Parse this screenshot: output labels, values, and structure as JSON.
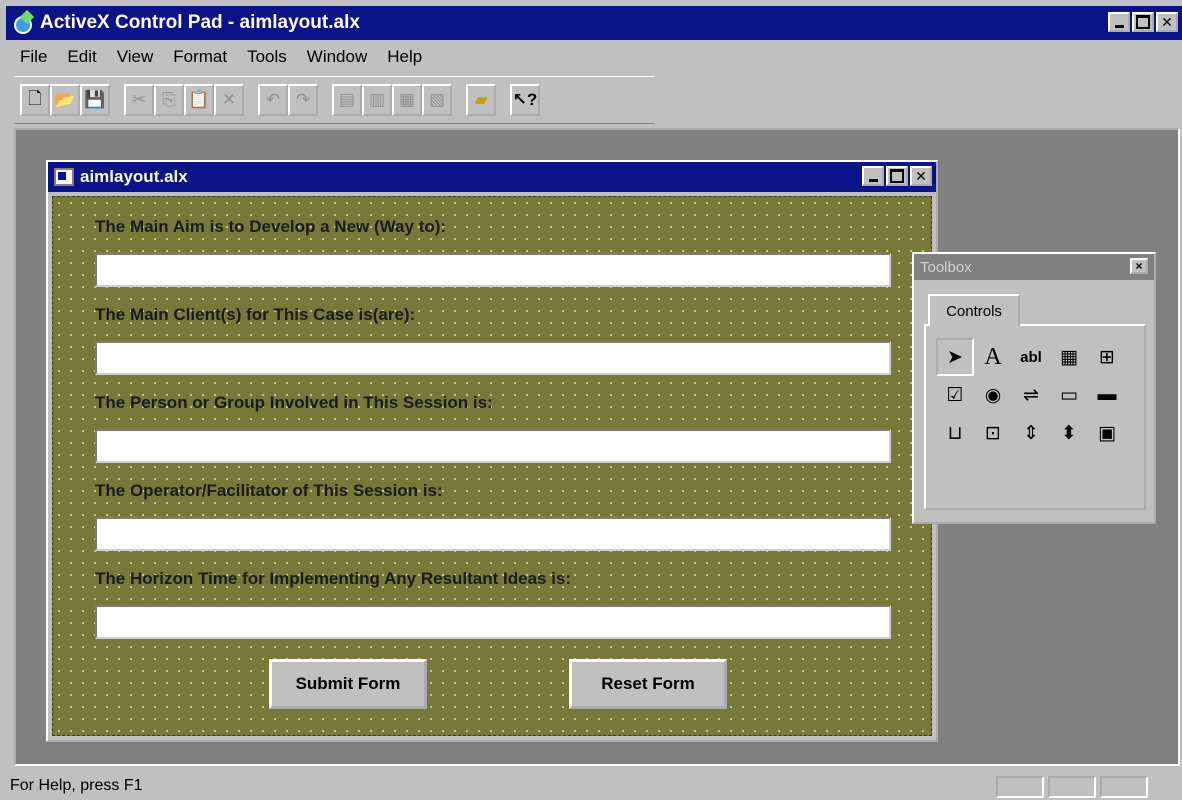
{
  "app": {
    "title": "ActiveX Control Pad - aimlayout.alx",
    "menu": [
      "File",
      "Edit",
      "View",
      "Format",
      "Tools",
      "Window",
      "Help"
    ]
  },
  "toolbar": {
    "new_icon": "new-file-icon",
    "open_icon": "open-folder-icon",
    "save_icon": "save-icon",
    "help_icon": "whats-this-icon"
  },
  "document": {
    "title": "aimlayout.alx",
    "background_color": "#787838",
    "fields": [
      {
        "label": "The Main Aim is to Develop a New (Way to):",
        "value": ""
      },
      {
        "label": "The Main Client(s) for This Case is(are):",
        "value": ""
      },
      {
        "label": "The Person or Group Involved in This Session is:",
        "value": ""
      },
      {
        "label": "The Operator/Facilitator of This Session is:",
        "value": ""
      },
      {
        "label": "The Horizon Time for Implementing Any Resultant Ideas is:",
        "value": ""
      }
    ],
    "submit_label": "Submit Form",
    "reset_label": "Reset Form"
  },
  "toolbox": {
    "title": "Toolbox",
    "tab": "Controls",
    "close": "×",
    "tools": [
      {
        "name": "pointer-icon",
        "glyph": "➤"
      },
      {
        "name": "label-icon",
        "glyph": "A"
      },
      {
        "name": "textbox-icon",
        "glyph": "abl"
      },
      {
        "name": "combobox-icon",
        "glyph": "▦"
      },
      {
        "name": "listbox-icon",
        "glyph": "⊞"
      },
      {
        "name": "checkbox-icon",
        "glyph": "☑"
      },
      {
        "name": "option-button-icon",
        "glyph": "◉"
      },
      {
        "name": "toggle-button-icon",
        "glyph": "⇌"
      },
      {
        "name": "frame-icon",
        "glyph": "▭"
      },
      {
        "name": "command-button-icon",
        "glyph": "▬"
      },
      {
        "name": "tabstrip-icon",
        "glyph": "⊔"
      },
      {
        "name": "multipage-icon",
        "glyph": "⊡"
      },
      {
        "name": "scrollbar-icon",
        "glyph": "⇕"
      },
      {
        "name": "spin-button-icon",
        "glyph": "⬍"
      },
      {
        "name": "image-icon",
        "glyph": "▣"
      }
    ]
  },
  "status": {
    "text": "For Help, press F1"
  }
}
